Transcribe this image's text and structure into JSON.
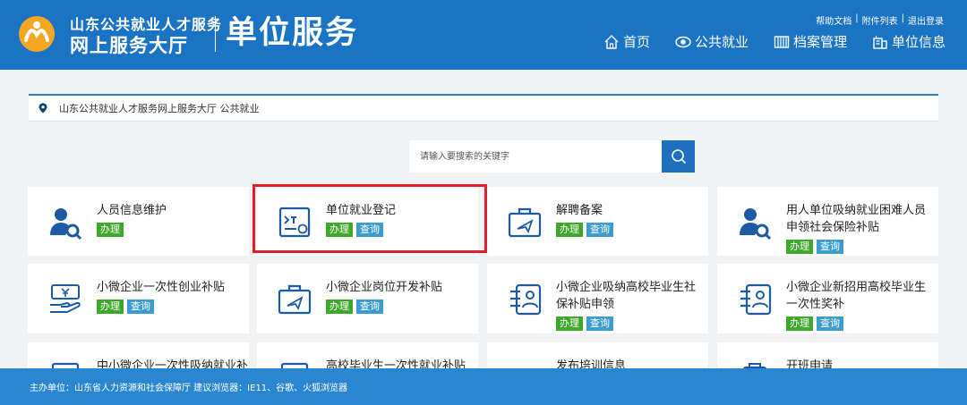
{
  "header": {
    "brand_top": "山东公共就业人才服务",
    "brand_bottom": "网上服务大厅",
    "brand_service": "单位服务",
    "top_links": [
      "帮助文档",
      "|",
      "附件列表",
      "|",
      "退出登录"
    ],
    "nav": [
      {
        "label": "首页",
        "icon": "home-icon"
      },
      {
        "label": "公共就业",
        "icon": "eye-icon"
      },
      {
        "label": "档案管理",
        "icon": "archive-icon"
      },
      {
        "label": "单位信息",
        "icon": "building-icon"
      }
    ]
  },
  "breadcrumb": {
    "text": "山东公共就业人才服务网上服务大厅 公共就业"
  },
  "search": {
    "placeholder": "请输入要搜索的关键字"
  },
  "tags": {
    "handle": "办理",
    "query": "查询"
  },
  "cards": [
    {
      "title": "人员信息维护",
      "icon": "person-wrench-icon"
    },
    {
      "title": "单位就业登记",
      "icon": "register-card-icon"
    },
    {
      "title": "解聘备案",
      "icon": "briefcase-icon"
    },
    {
      "title": "用人单位吸纳就业困难人员申领社会保险补贴",
      "icon": "person-wrench-icon"
    },
    {
      "title": "小微企业一次性创业补贴",
      "icon": "money-hand-icon"
    },
    {
      "title": "小微企业岗位开发补贴",
      "icon": "briefcase-icon"
    },
    {
      "title": "小微企业吸纳高校毕业生社保补贴申领",
      "icon": "id-card-icon"
    },
    {
      "title": "小微企业新招用高校毕业生一次性奖补",
      "icon": "id-card-icon"
    },
    {
      "title": "中小微企业一次性吸纳就业补贴",
      "icon": "document-icon"
    },
    {
      "title": "高校毕业生一次性就业补贴",
      "icon": "document-icon"
    },
    {
      "title": "发布培训信息",
      "icon": "megaphone-icon"
    },
    {
      "title": "开班申请",
      "icon": "clipboard-icon"
    }
  ],
  "footer": {
    "text": "主办单位：山东省人力资源和社会保障厅   建议浏览器：IE11、谷歌、火狐浏览器"
  },
  "colors": {
    "header": "#1a73c3",
    "accent": "#1e6fbd",
    "green": "#3ea82b",
    "blue": "#3d9dce",
    "highlight": "#e21f26"
  }
}
